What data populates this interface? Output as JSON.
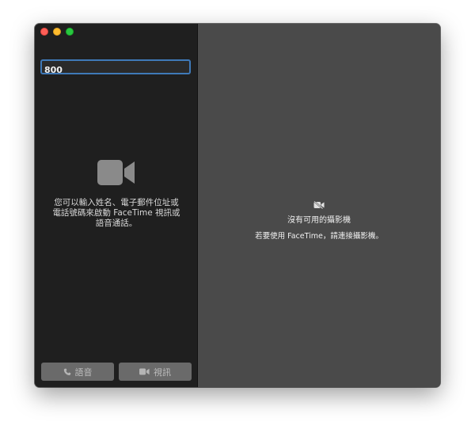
{
  "window": {
    "traffic_lights": {
      "close_color": "#fe5f57",
      "minimize_color": "#febc2e",
      "zoom_color": "#28c840"
    }
  },
  "sidebar": {
    "search_value": "800",
    "camera_icon": "video-camera-icon",
    "hint_text": "您可以輸入姓名、電子郵件位址或\n電話號碼來啟動 FaceTime 視訊或\n語音通話。",
    "buttons": {
      "audio_label": "語音",
      "audio_icon": "phone-icon",
      "video_label": "視訊",
      "video_icon": "video-camera-icon"
    }
  },
  "main": {
    "icon": "video-camera-off-icon",
    "title": "沒有可用的攝影機",
    "subtitle": "若要使用 FaceTime，請連接攝影機。"
  }
}
